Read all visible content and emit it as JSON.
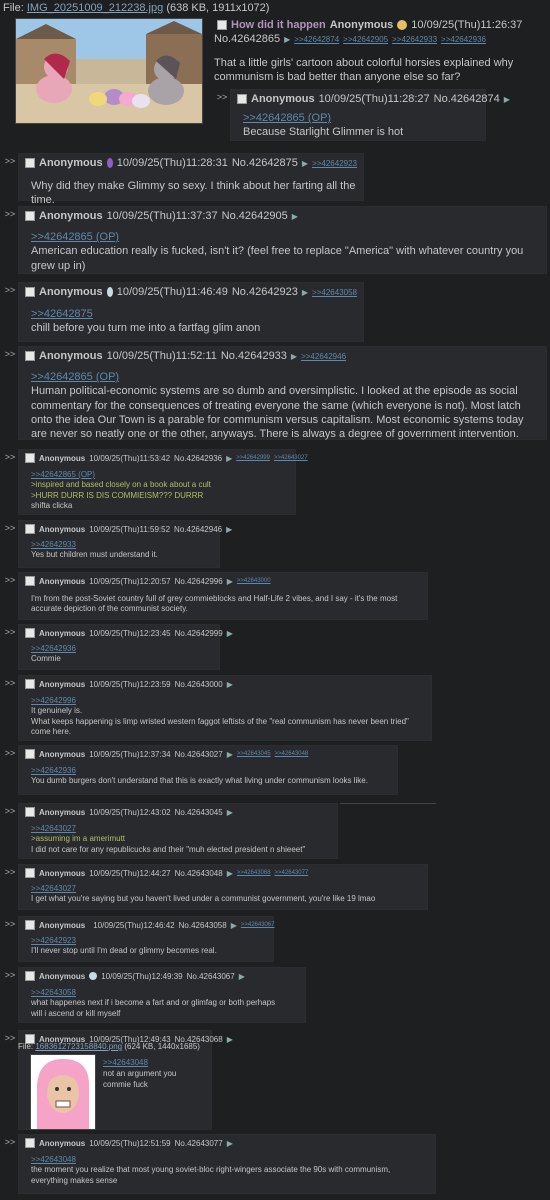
{
  "op": {
    "file_label": "File:",
    "file_name": "IMG_20251009_212238.jpg",
    "file_info": "(638 KB, 1911x1072)",
    "subject": "How did it happen",
    "name": "Anonymous",
    "date": "10/09/25(Thu)11:26:37",
    "no": "No.42642865",
    "backlinks": [
      ">>42642874",
      ">>42642905",
      ">>42642933",
      ">>42642936"
    ],
    "text": "That a little girls' cartoon about colorful horsies explained why communism is bad better than anyone else so far?"
  },
  "replies": [
    {
      "id": "r1",
      "name": "Anonymous",
      "date": "10/09/25(Thu)11:28:27",
      "no": "No.42642874",
      "backlinks": [],
      "lines": [
        {
          "t": "q",
          "v": ">>42642865 (OP)"
        },
        {
          "t": "x",
          "v": "Because Starlight Glimmer is hot"
        }
      ]
    },
    {
      "id": "r2",
      "name": "Anonymous",
      "date": "10/09/25(Thu)11:28:31",
      "no": "No.42642875",
      "backlinks": [
        ">>42642923"
      ],
      "lines": [
        {
          "t": "x",
          "v": "Why did they make Glimmy so sexy. I think about her farting all the time."
        }
      ]
    },
    {
      "id": "r3",
      "name": "Anonymous",
      "date": "10/09/25(Thu)11:37:37",
      "no": "No.42642905",
      "backlinks": [],
      "lines": [
        {
          "t": "q",
          "v": ">>42642865 (OP)"
        },
        {
          "t": "x",
          "v": "American education really is fucked, isn't it? (feel free to replace \"America\" with whatever country you grew up in)"
        }
      ]
    },
    {
      "id": "r4",
      "name": "Anonymous",
      "date": "10/09/25(Thu)11:46:49",
      "no": "No.42642923",
      "backlinks": [
        ">>42643058"
      ],
      "lines": [
        {
          "t": "q",
          "v": ">>42642875"
        },
        {
          "t": "x",
          "v": "chill before you turn me into a fartfag glim anon"
        }
      ]
    },
    {
      "id": "r5",
      "name": "Anonymous",
      "date": "10/09/25(Thu)11:52:11",
      "no": "No.42642933",
      "backlinks": [
        ">>42642946"
      ],
      "lines": [
        {
          "t": "q",
          "v": ">>42642865 (OP)"
        },
        {
          "t": "x",
          "v": "Human political-economic systems are so dumb and oversimplistic. I looked at the episode as social commentary for the consequences of treating everyone the same (which everyone is not). Most latch onto the idea Our Town is a parable for communism versus capitalism. Most economic systems today are never so neatly one or the other, anyways. There is always a degree of government intervention."
        }
      ]
    },
    {
      "id": "r6",
      "name": "Anonymous",
      "date": "10/09/25(Thu)11:53:42",
      "no": "No.42642936",
      "backlinks": [
        ">>42642999",
        ">>42643027"
      ],
      "lines": [
        {
          "t": "q",
          "v": ">>42642865 (OP)"
        },
        {
          "t": "g",
          "v": ">inspired and based closely on a book about a cult"
        },
        {
          "t": "g",
          "v": ">HURR DURR IS DIS COMMIEISM??? DURRR"
        },
        {
          "t": "x",
          "v": "shifta clicka"
        }
      ]
    },
    {
      "id": "r7",
      "name": "Anonymous",
      "date": "10/09/25(Thu)11:59:52",
      "no": "No.42642946",
      "backlinks": [],
      "lines": [
        {
          "t": "q",
          "v": ">>42642933"
        },
        {
          "t": "x",
          "v": "Yes but children must understand it."
        }
      ]
    },
    {
      "id": "r8",
      "name": "Anonymous",
      "date": "10/09/25(Thu)12:20:57",
      "no": "No.42642996",
      "backlinks": [
        ">>42643000"
      ],
      "lines": [
        {
          "t": "x",
          "v": "I'm from the post-Soviet country full of grey commieblocks and Half-Life 2 vibes, and I say - it's the most accurate depiction of the communist society."
        }
      ]
    },
    {
      "id": "r9",
      "name": "Anonymous",
      "date": "10/09/25(Thu)12:23:45",
      "no": "No.42642999",
      "backlinks": [],
      "lines": [
        {
          "t": "q",
          "v": ">>42642936"
        },
        {
          "t": "x",
          "v": "Commie"
        }
      ]
    },
    {
      "id": "r10",
      "name": "Anonymous",
      "date": "10/09/25(Thu)12:23:59",
      "no": "No.42643000",
      "backlinks": [],
      "lines": [
        {
          "t": "q",
          "v": ">>42642996"
        },
        {
          "t": "x",
          "v": "It genuinely is."
        },
        {
          "t": "x",
          "v": "What keeps happening is limp wristed western faggot leftists of the \"real communism has never been tried\" come here."
        }
      ]
    },
    {
      "id": "r11",
      "name": "Anonymous",
      "date": "10/09/25(Thu)12:37:34",
      "no": "No.42643027",
      "backlinks": [
        ">>42643045",
        ">>42643048"
      ],
      "lines": [
        {
          "t": "q",
          "v": ">>42642936"
        },
        {
          "t": "x",
          "v": "You dumb burgers don't understand that this is exactly what living under communism looks like."
        }
      ]
    },
    {
      "id": "r12",
      "name": "Anonymous",
      "date": "10/09/25(Thu)12:43:02",
      "no": "No.42643045",
      "backlinks": [],
      "lines": [
        {
          "t": "q",
          "v": ">>42643027"
        },
        {
          "t": "g",
          "v": ">assuming im a amerimutt"
        },
        {
          "t": "x",
          "v": "I did not care for any republicucks and their \"muh elected president n shieeet\""
        }
      ]
    },
    {
      "id": "r13",
      "name": "Anonymous",
      "date": "10/09/25(Thu)12:44:27",
      "no": "No.42643048",
      "backlinks": [
        ">>42643068",
        ">>42643077"
      ],
      "lines": [
        {
          "t": "q",
          "v": ">>42643027"
        },
        {
          "t": "x",
          "v": "I get what you're saying but you haven't lived under a communist government, you're like 19 lmao"
        }
      ]
    },
    {
      "id": "r14",
      "name": "Anonymous",
      "date": "10/09/25(Thu)12:46:42",
      "no": "No.42643058",
      "backlinks": [
        ">>42643067"
      ],
      "lines": [
        {
          "t": "q",
          "v": ">>42642923"
        },
        {
          "t": "x",
          "v": "I'll never stop until I'm dead or glimmy becomes real."
        }
      ]
    },
    {
      "id": "r15",
      "name": "Anonymous",
      "date": "10/09/25(Thu)12:49:39",
      "no": "No.42643067",
      "backlinks": [],
      "lines": [
        {
          "t": "q",
          "v": ">>42643058"
        },
        {
          "t": "x",
          "v": "what happenes next if i become a fart and or glimfag or both perhaps"
        },
        {
          "t": "x",
          "v": "will i ascend or kill myself"
        }
      ]
    },
    {
      "id": "r16",
      "name": "Anonymous",
      "date": "10/09/25(Thu)12:49:43",
      "no": "No.42643068",
      "file_label": "File:",
      "file_name": "1683612723158840.png",
      "file_info": "(624 KB, 1440x1685)",
      "backlinks": [],
      "lines": [
        {
          "t": "q",
          "v": ">>42643048"
        },
        {
          "t": "x",
          "v": "not an argument you"
        },
        {
          "t": "x",
          "v": "commie fuck"
        }
      ]
    },
    {
      "id": "r17",
      "name": "Anonymous",
      "date": "10/09/25(Thu)12:51:59",
      "no": "No.42643077",
      "backlinks": [],
      "lines": [
        {
          "t": "q",
          "v": ">>42643048"
        },
        {
          "t": "x",
          "v": "the moment you realize that most young soviet-bloc right-wingers associate the 90s with communism, everything makes sense"
        }
      ]
    }
  ],
  "arrow_glyph": ">>"
}
